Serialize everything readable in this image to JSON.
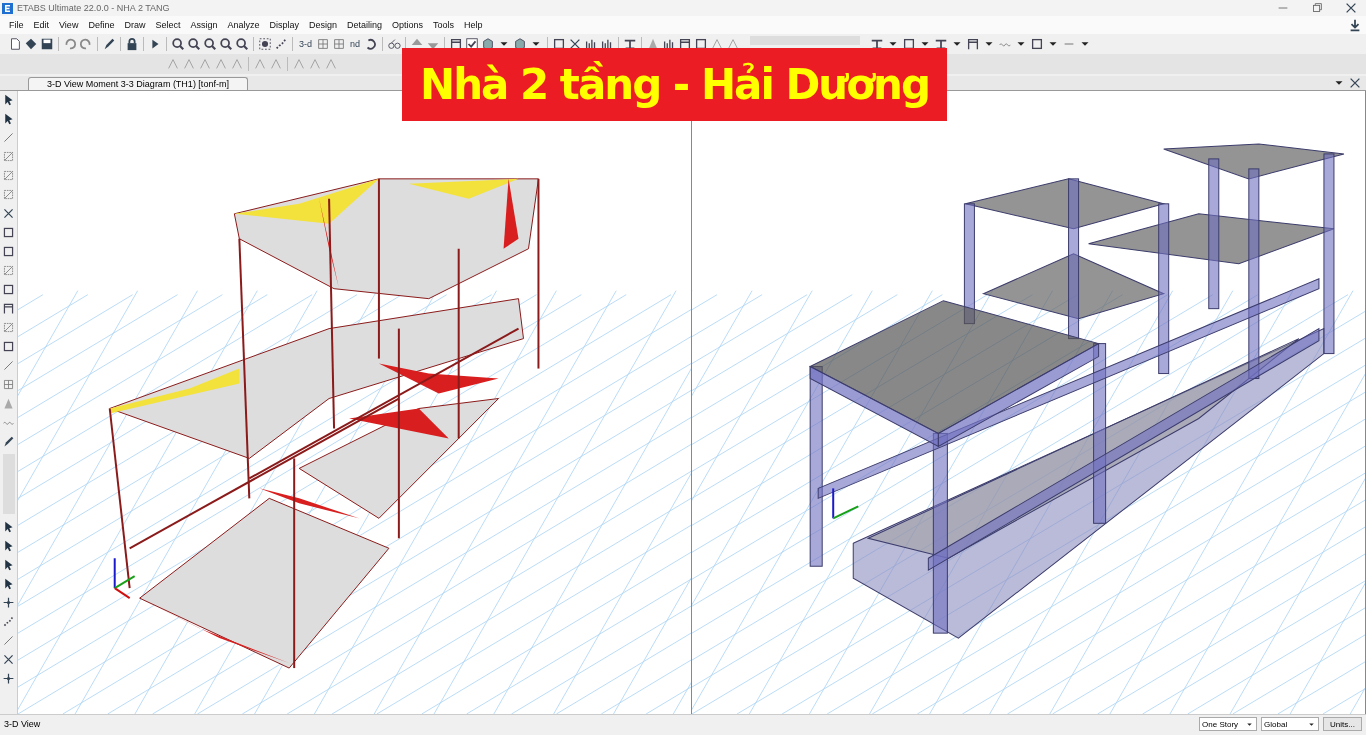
{
  "window": {
    "title": "ETABS Ultimate 22.0.0 - NHA 2 TANG"
  },
  "menu": [
    "File",
    "Edit",
    "View",
    "Define",
    "Draw",
    "Select",
    "Assign",
    "Analyze",
    "Display",
    "Design",
    "Detailing",
    "Options",
    "Tools",
    "Help"
  ],
  "toolbar": {
    "text_buttons": [
      "3-d",
      "nd"
    ]
  },
  "tabs": [
    {
      "label": "3-D View   Moment 3-3 Diagram   (TH1)  [tonf-m]",
      "selected": true
    }
  ],
  "banner": {
    "text": "Nhà 2 tầng - Hải Dương"
  },
  "status_bar": {
    "text": "3-D View",
    "story_select": "One Story",
    "coord_select": "Global",
    "units_button": "Units..."
  }
}
